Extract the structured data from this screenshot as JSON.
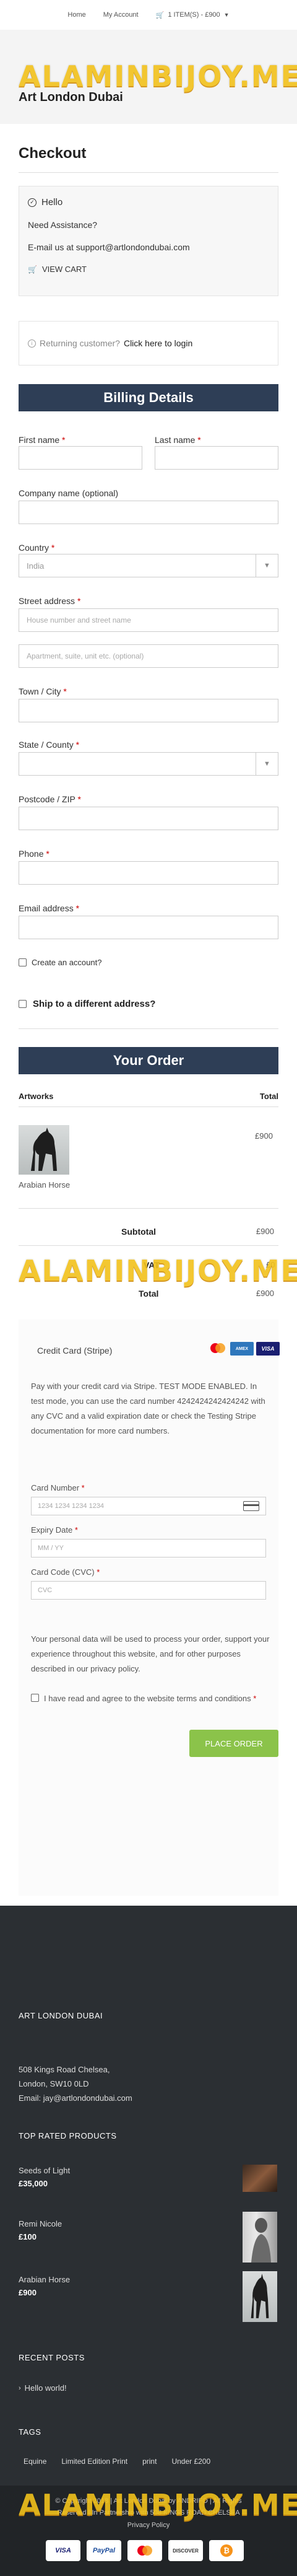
{
  "topnav": {
    "home": "Home",
    "account": "My Account",
    "cart": "1 ITEM(S) - £900"
  },
  "watermark": "ALAMINBIJOY.ME",
  "site_title": "Art London Dubai",
  "checkout": {
    "title": "Checkout",
    "assist": {
      "hello": "Hello",
      "need": "Need Assistance?",
      "email": "E-mail us at support@artlondondubai.com",
      "view_cart": "VIEW CART"
    },
    "returning": {
      "prefix": "Returning customer?",
      "link": "Click here to login"
    }
  },
  "billing": {
    "heading": "Billing Details",
    "first_name": "First name",
    "last_name": "Last name",
    "company": "Company name (optional)",
    "country": "Country",
    "country_value": "India",
    "street": "Street address",
    "street_ph1": "House number and street name",
    "street_ph2": "Apartment, suite, unit etc. (optional)",
    "city": "Town / City",
    "state": "State / County",
    "postcode": "Postcode / ZIP",
    "phone": "Phone",
    "email": "Email address",
    "create_account": "Create an account?",
    "ship_different": "Ship to a different address?",
    "required_mark": "*"
  },
  "order": {
    "heading": "Your Order",
    "col_artworks": "Artworks",
    "col_total": "Total",
    "item_name": "Arabian Horse",
    "item_price": "£900",
    "subtotal_label": "Subtotal",
    "subtotal_value": "£900",
    "vat_label": "VAT",
    "vat_value": "£0",
    "total_label": "Total",
    "total_value": "£900"
  },
  "payment": {
    "method": "Credit Card (Stripe)",
    "description": "Pay with your credit card via Stripe. TEST MODE ENABLED. In test mode, you can use the card number 4242424242424242 with any CVC and a valid expiration date or check the Testing Stripe documentation for more card numbers.",
    "card_number_label": "Card Number",
    "card_number_ph": "1234 1234 1234 1234",
    "expiry_label": "Expiry Date",
    "expiry_ph": "MM / YY",
    "cvc_label": "Card Code (CVC)",
    "cvc_ph": "CVC",
    "privacy": "Your personal data will be used to process your order, support your experience throughout this website, and for other purposes described in our privacy policy.",
    "terms": "I have read and agree to the website terms and conditions",
    "place_order": "PLACE ORDER",
    "brands": [
      "MC",
      "AMEX",
      "VISA"
    ]
  },
  "footer": {
    "company": "ART LONDON DUBAI",
    "addr1": "508 Kings Road Chelsea,",
    "addr2": "London, SW10 0LD",
    "email": "Email: jay@artlondondubai.com",
    "top_rated": "TOP RATED PRODUCTS",
    "products": [
      {
        "name": "Seeds of Light",
        "price": "£35,000"
      },
      {
        "name": "Remi Nicole",
        "price": "£100"
      },
      {
        "name": "Arabian Horse",
        "price": "£900"
      }
    ],
    "recent_posts": "RECENT POSTS",
    "post": "Hello world!",
    "tags_title": "TAGS",
    "tags": [
      "Equine",
      "Limited Edition Print",
      "print",
      "Under £200"
    ],
    "copyright1": "© Copyright 2018 | Art London Dubai by ANDRIFO | All Rights",
    "copyright2": "Reserved | In Partnership with 508 KINGS ROAD CHELSEA",
    "copyright3": "Privacy Policy",
    "payments": [
      "VISA",
      "PayPal",
      "MC",
      "DISCOVER",
      "BTC"
    ]
  },
  "colors": {
    "banner": "#2e3e56",
    "accent_button": "#8bc34a",
    "watermark": "#f2c21b",
    "footer": "#2b2f33"
  }
}
